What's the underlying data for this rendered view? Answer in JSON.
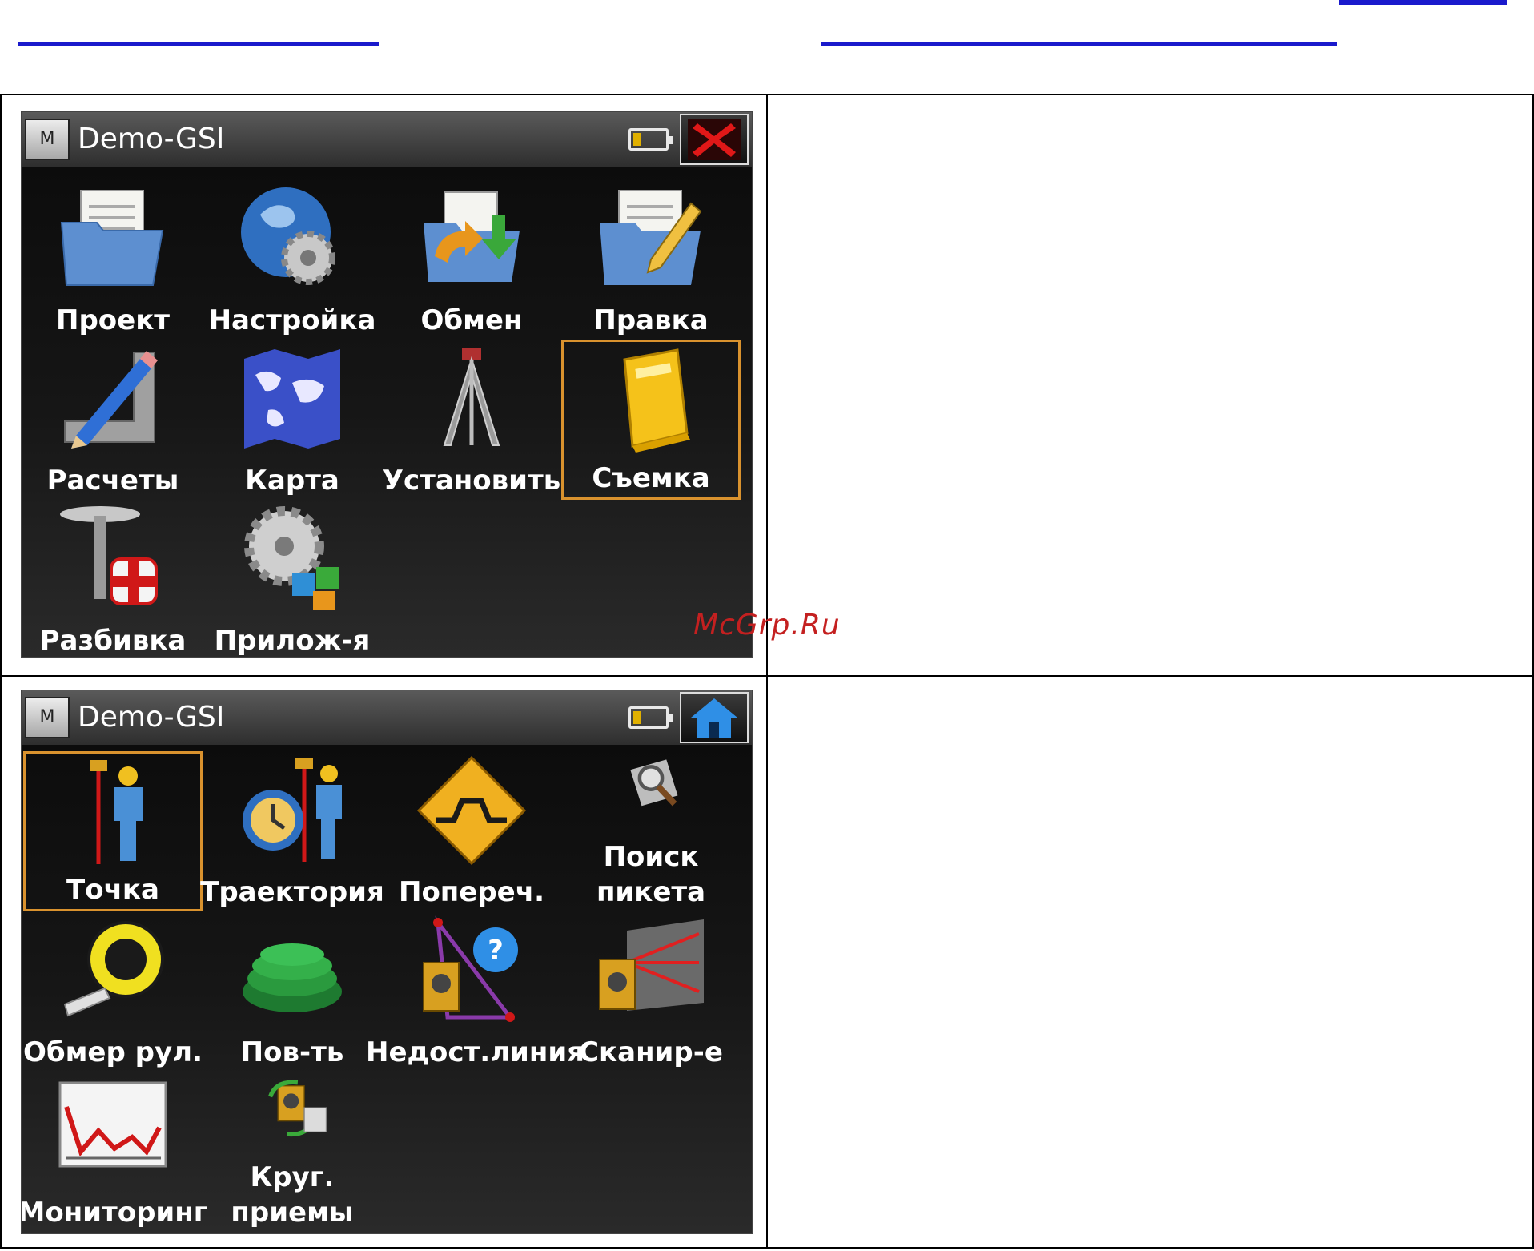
{
  "watermark": "McGrp.Ru",
  "colors": {
    "selection": "#d9922e",
    "link": "#1a1acc",
    "watermark": "#c42020"
  },
  "screen1": {
    "title": "Demo-GSI",
    "menu_button": "M",
    "corner_icon": "close-icon",
    "battery_level": 0.15,
    "tiles": [
      {
        "label": "Проект",
        "icon": "project-folder-icon",
        "selected": false
      },
      {
        "label": "Настройка",
        "icon": "settings-globe-icon",
        "selected": false
      },
      {
        "label": "Обмен",
        "icon": "exchange-icon",
        "selected": false
      },
      {
        "label": "Правка",
        "icon": "edit-icon",
        "selected": false
      },
      {
        "label": "Расчеты",
        "icon": "calculations-icon",
        "selected": false
      },
      {
        "label": "Карта",
        "icon": "map-icon",
        "selected": false
      },
      {
        "label": "Установить",
        "icon": "tripod-icon",
        "selected": false
      },
      {
        "label": "Съемка",
        "icon": "survey-book-icon",
        "selected": true
      },
      {
        "label": "Разбивка",
        "icon": "stakeout-icon",
        "selected": false
      },
      {
        "label": "Прилож-я",
        "icon": "applications-icon",
        "selected": false
      }
    ]
  },
  "screen2": {
    "title": "Demo-GSI",
    "menu_button": "M",
    "corner_icon": "home-icon",
    "battery_level": 0.15,
    "tiles": [
      {
        "label": "Точка",
        "icon": "point-icon",
        "selected": true
      },
      {
        "label": "Траектория",
        "icon": "trajectory-icon",
        "selected": false
      },
      {
        "label": "Попереч.",
        "icon": "cross-section-icon",
        "selected": false
      },
      {
        "label": "Поиск пикета",
        "line1": "Поиск",
        "line2": "пикета",
        "icon": "station-search-icon",
        "selected": false
      },
      {
        "label": "Обмер рул.",
        "icon": "tape-measure-icon",
        "selected": false
      },
      {
        "label": "Пов-ть",
        "icon": "surface-icon",
        "selected": false
      },
      {
        "label": "Недост.линия",
        "icon": "missing-line-icon",
        "selected": false
      },
      {
        "label": "Сканир-е",
        "icon": "scanning-icon",
        "selected": false
      },
      {
        "label": "Мониторинг",
        "icon": "monitoring-icon",
        "selected": false
      },
      {
        "label": "Круг. приемы",
        "line1": "Круг.",
        "line2": "приемы",
        "icon": "sets-of-angles-icon",
        "selected": false
      }
    ]
  }
}
